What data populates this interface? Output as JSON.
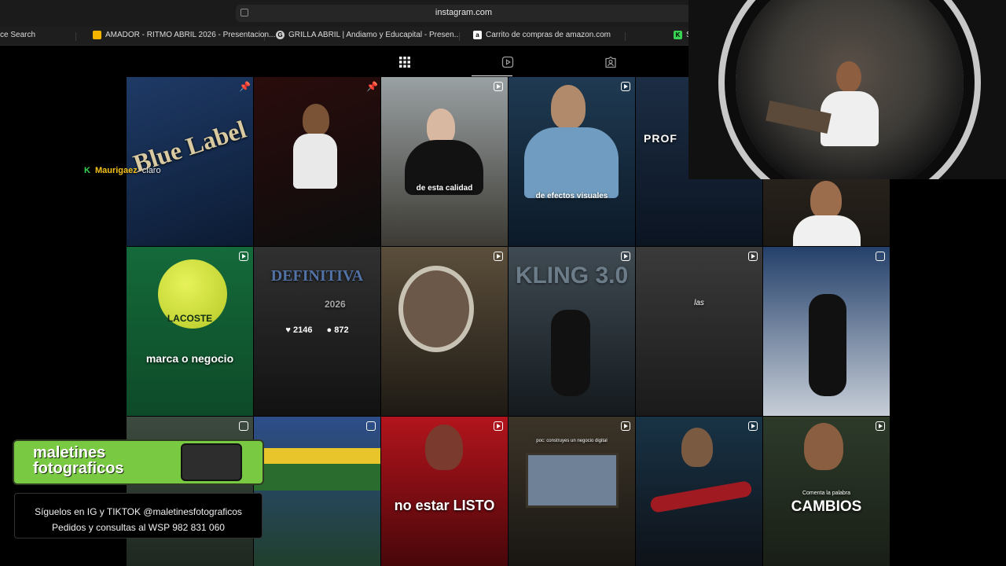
{
  "browser": {
    "url": "instagram.com",
    "bookmarks": [
      {
        "label": "ce Search",
        "icon": "search-favicon",
        "color": "#1e1e1e"
      },
      {
        "label": "AMADOR - RITMO ABRIL 2026 - Presentacion...",
        "icon": "slides-favicon",
        "color": "#f4b400"
      },
      {
        "label": "GRILLA ABRIL | Andiamo y Educapital - Presen...",
        "icon": "g-favicon",
        "color": "#cfcfcf"
      },
      {
        "label": "Carrito de compras de amazon.com",
        "icon": "amazon-favicon",
        "color": "#ffffff"
      },
      {
        "label": "St",
        "icon": "kick-favicon",
        "color": "#39d353"
      }
    ]
  },
  "profile_tabs": {
    "posts_icon": "grid-icon",
    "reels_icon": "reels-icon",
    "tagged_icon": "tagged-icon",
    "active": "posts"
  },
  "chat": {
    "platform_icon": "K",
    "username": "Maurigaez",
    "message": "claro"
  },
  "tiles": [
    {
      "type": "pin",
      "caption": "",
      "bg": "linear-gradient(160deg,#1e3a66,#0c1b33)",
      "text": "Blue Label"
    },
    {
      "type": "pin",
      "caption": "",
      "bg": "linear-gradient(160deg,#2a0c0c,#0d0d0d)",
      "text": ""
    },
    {
      "type": "reel",
      "caption": "de esta calidad",
      "bg": "linear-gradient(180deg,#9aa1a3,#3c3a33)",
      "text": ""
    },
    {
      "type": "reel",
      "caption": "de efectos visuales",
      "bg": "linear-gradient(180deg,#1f3a52,#0c1a28)",
      "text": ""
    },
    {
      "type": "reel",
      "caption": "PROF",
      "bg": "linear-gradient(180deg,#1c2d44,#0b1421)",
      "text": ""
    },
    {
      "type": "reel",
      "caption": "",
      "bg": "linear-gradient(180deg,#3a3229,#1b1713)",
      "text": ""
    },
    {
      "type": "reel",
      "caption": "marca o negocio",
      "bg": "linear-gradient(180deg,#146a3a,#0e4a28)",
      "text": "LACOSTE"
    },
    {
      "type": "hover",
      "caption": "DEFINITIVA",
      "bg": "linear-gradient(180deg,#4b4b4b,#1c1c1c)",
      "text": ""
    },
    {
      "type": "reel",
      "caption": "",
      "bg": "linear-gradient(180deg,#5b4e3b,#1e1a14)",
      "text": ""
    },
    {
      "type": "reel",
      "caption": "KLING 3.0",
      "bg": "linear-gradient(180deg,#3f4a52,#141a1e)",
      "text": ""
    },
    {
      "type": "reel",
      "caption": "las",
      "bg": "linear-gradient(180deg,#3a3a3a,#1a1a1a)",
      "text": ""
    },
    {
      "type": "carousel",
      "caption": "",
      "bg": "linear-gradient(180deg,#24406a,#c7ced8)",
      "text": ""
    },
    {
      "type": "carousel",
      "caption": "",
      "bg": "linear-gradient(180deg,#3c4a3f,#1a231c)",
      "text": ""
    },
    {
      "type": "carousel",
      "caption": "",
      "bg": "linear-gradient(180deg,#2d4e8a,#1e3d20)",
      "text": ""
    },
    {
      "type": "reel",
      "caption": "no estar LISTO",
      "bg": "linear-gradient(180deg,#b3141c,#3a0508)",
      "text": ""
    },
    {
      "type": "reel",
      "caption": "",
      "bg": "linear-gradient(180deg,#3c3428,#141210)",
      "text": "poc: construyes un negocio digital"
    },
    {
      "type": "reel",
      "caption": "",
      "bg": "linear-gradient(180deg,#183346,#0d0d12)",
      "text": ""
    },
    {
      "type": "reel",
      "caption": "CAMBIOS",
      "bg": "linear-gradient(180deg,#2d3a2a,#161b14)",
      "text": "Comenta la palabra"
    }
  ],
  "hover_stats": {
    "likes": "2146",
    "comments": "872",
    "year": "2026"
  },
  "promo": {
    "line1": "maletines",
    "line2": "fotograficos",
    "follow": "Síguelos en IG y TIKTOK @maletinesfotograficos",
    "orders": "Pedidos y consultas al WSP 982 831 060"
  }
}
